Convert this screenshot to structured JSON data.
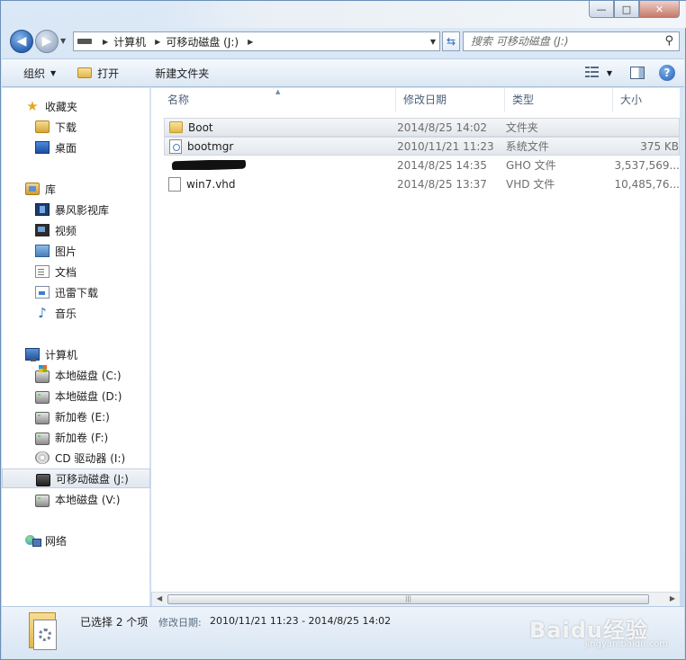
{
  "window": {
    "caption_min": "—",
    "caption_max": "□",
    "caption_close": "✕"
  },
  "address": {
    "segments": [
      "计算机",
      "可移动磁盘 (J:)"
    ]
  },
  "search": {
    "placeholder": "搜索 可移动磁盘 (J:)"
  },
  "toolbar": {
    "organize": "组织",
    "open": "打开",
    "new_folder": "新建文件夹"
  },
  "nav": {
    "favorites": "收藏夹",
    "downloads": "下载",
    "desktop": "桌面",
    "libraries": "库",
    "storm": "暴风影视库",
    "video": "视频",
    "pictures": "图片",
    "documents": "文档",
    "thunder": "迅雷下载",
    "music": "音乐",
    "computer": "计算机",
    "drive_c": "本地磁盘 (C:)",
    "drive_d": "本地磁盘 (D:)",
    "drive_e": "新加卷 (E:)",
    "drive_f": "新加卷 (F:)",
    "drive_i": "CD 驱动器 (I:)",
    "drive_j": "可移动磁盘 (J:)",
    "drive_v": "本地磁盘 (V:)",
    "network": "网络"
  },
  "columns": {
    "name": "名称",
    "date": "修改日期",
    "type": "类型",
    "size": "大小"
  },
  "files": [
    {
      "name": "Boot",
      "date": "2014/8/25 14:02",
      "type": "文件夹",
      "size": "",
      "icon": "folder-icon"
    },
    {
      "name": "bootmgr",
      "date": "2010/11/21 11:23",
      "type": "系统文件",
      "size": "375 KB",
      "icon": "system-file-icon"
    },
    {
      "name": "",
      "date": "2014/8/25 14:35",
      "type": "GHO 文件",
      "size": "3,537,569...",
      "icon": "none"
    },
    {
      "name": "win7.vhd",
      "date": "2014/8/25 13:37",
      "type": "VHD 文件",
      "size": "10,485,76...",
      "icon": "file-icon"
    }
  ],
  "details": {
    "selection": "已选择 2 个项",
    "label": "修改日期:",
    "value": "2010/11/21 11:23 - 2014/8/25 14:02"
  },
  "watermark": {
    "text": "Baidu经验",
    "sub": "jingyan.baidu.com"
  }
}
